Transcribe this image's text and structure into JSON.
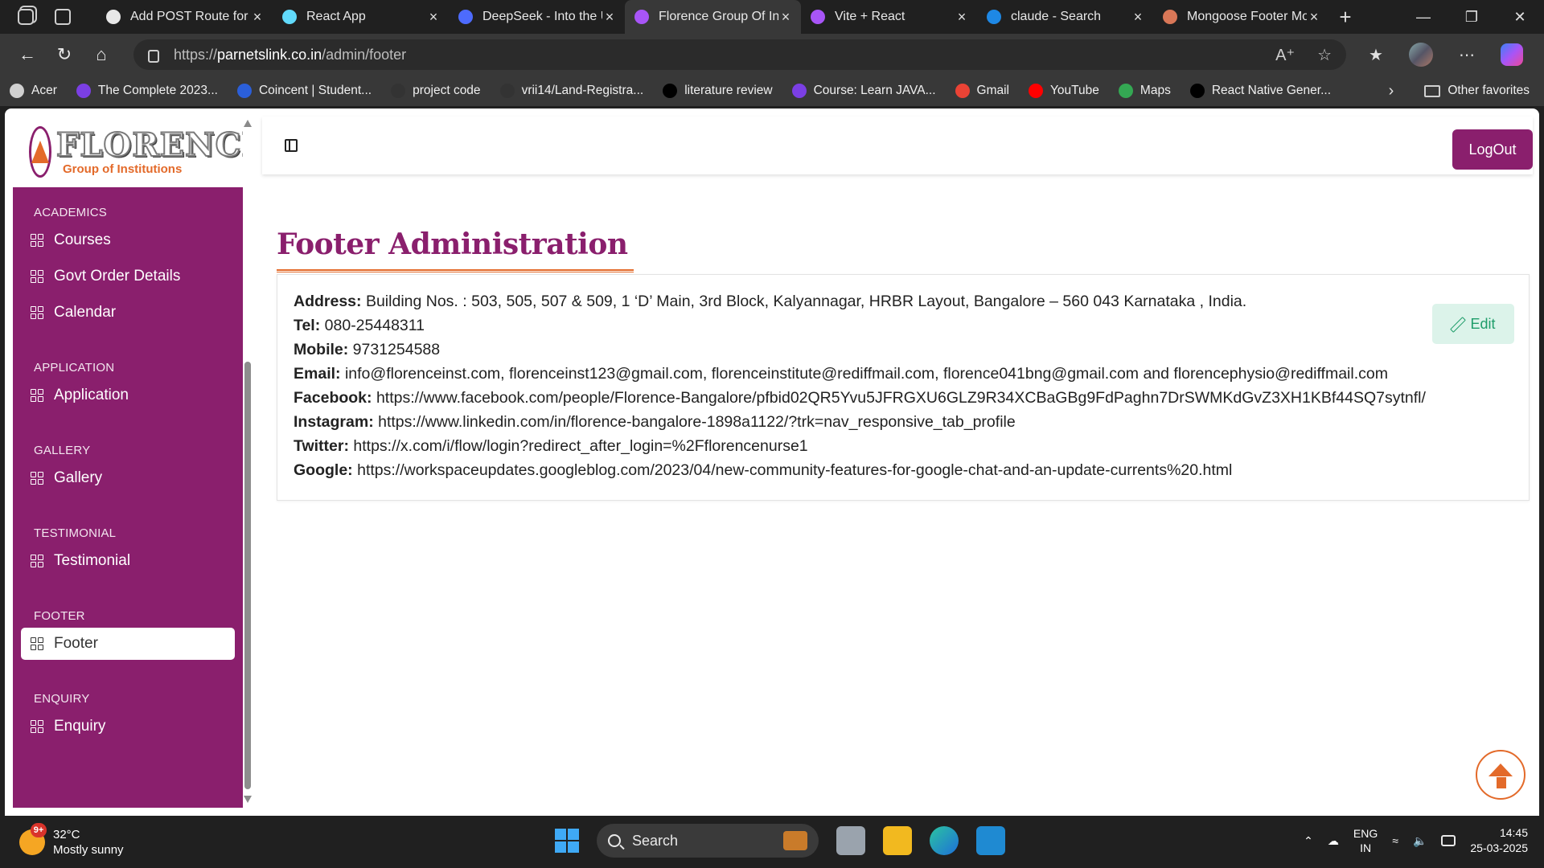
{
  "browser": {
    "tabs": [
      {
        "title": "Add POST Route for C",
        "favicon_color": "#e8e8e8",
        "active": false
      },
      {
        "title": "React App",
        "favicon_color": "#61dafb",
        "active": false
      },
      {
        "title": "DeepSeek - Into the U",
        "favicon_color": "#4d6bfe",
        "active": false
      },
      {
        "title": "Florence Group Of Ins",
        "favicon_color": "#a855f7",
        "active": true
      },
      {
        "title": "Vite + React",
        "favicon_color": "#a855f7",
        "active": false
      },
      {
        "title": "claude - Search",
        "favicon_color": "#1e88e5",
        "active": false
      },
      {
        "title": "Mongoose Footer Mo",
        "favicon_color": "#d97757",
        "active": false
      }
    ],
    "url_scheme": "https://",
    "url_host": "parnetslink.co.in",
    "url_path": "/admin/footer",
    "bookmarks": [
      {
        "label": "Acer",
        "color": "#d0d0d0"
      },
      {
        "label": "The Complete 2023...",
        "color": "#7b3fe4"
      },
      {
        "label": "Coincent | Student...",
        "color": "#2b5fd9"
      },
      {
        "label": "project code",
        "color": "#333333"
      },
      {
        "label": "vrii14/Land-Registra...",
        "color": "#333333"
      },
      {
        "label": "literature review",
        "color": "#000000"
      },
      {
        "label": "Course: Learn JAVA...",
        "color": "#7b3fe4"
      },
      {
        "label": "Gmail",
        "color": "#ea4335"
      },
      {
        "label": "YouTube",
        "color": "#ff0000"
      },
      {
        "label": "Maps",
        "color": "#34a853"
      },
      {
        "label": "React Native Gener...",
        "color": "#000000"
      }
    ],
    "other_favorites": "Other favorites"
  },
  "sidebar": {
    "logo_main": "FLORENCE",
    "logo_sub": "Group of Institutions",
    "sections": [
      {
        "heading": "ACADEMICS",
        "items": [
          "Courses",
          "Govt Order Details",
          "Calendar"
        ]
      },
      {
        "heading": "APPLICATION",
        "items": [
          "Application"
        ]
      },
      {
        "heading": "GALLERY",
        "items": [
          "Gallery"
        ]
      },
      {
        "heading": "TESTIMONIAL",
        "items": [
          "Testimonial"
        ]
      },
      {
        "heading": "FOOTER",
        "items": [
          "Footer"
        ]
      },
      {
        "heading": "ENQUIRY",
        "items": [
          "Enquiry"
        ]
      }
    ],
    "active_item": "Footer"
  },
  "header": {
    "logout_label": "LogOut"
  },
  "main": {
    "title": "Footer Administration",
    "edit_label": "Edit",
    "footer_info": [
      {
        "label": "Address:",
        "value": "Building Nos. : 503, 505, 507 & 509, 1 ‘D’ Main, 3rd Block, Kalyannagar, HRBR Layout, Bangalore – 560 043 Karnataka , India."
      },
      {
        "label": "Tel:",
        "value": "080-25448311"
      },
      {
        "label": "Mobile:",
        "value": "9731254588"
      },
      {
        "label": "Email:",
        "value": "info@florenceinst.com, florenceinst123@gmail.com, florenceinstitute@rediffmail.com, florence041bng@gmail.com and florencephysio@rediffmail.com"
      },
      {
        "label": "Facebook:",
        "value": "https://www.facebook.com/people/Florence-Bangalore/pfbid02QR5Yvu5JFRGXU6GLZ9R34XCBaGBg9FdPaghn7DrSWMKdGvZ3XH1KBf44SQ7sytnfl/"
      },
      {
        "label": "Instagram:",
        "value": "https://www.linkedin.com/in/florence-bangalore-1898a1122/?trk=nav_responsive_tab_profile"
      },
      {
        "label": "Twitter:",
        "value": "https://x.com/i/flow/login?redirect_after_login=%2Fflorencenurse1"
      },
      {
        "label": "Google:",
        "value": "https://workspaceupdates.googleblog.com/2023/04/new-community-features-for-google-chat-and-an-update-currents%20.html"
      }
    ]
  },
  "taskbar": {
    "weather_temp": "32°C",
    "weather_desc": "Mostly sunny",
    "weather_badge": "9+",
    "search_label": "Search",
    "lang_top": "ENG",
    "lang_bottom": "IN",
    "time": "14:45",
    "date": "25-03-2025"
  },
  "colors": {
    "brand_primary": "#8a1f6d",
    "brand_accent": "#e36a2a",
    "edit_bg": "#dcf3ea",
    "edit_text": "#1f9d6a"
  }
}
